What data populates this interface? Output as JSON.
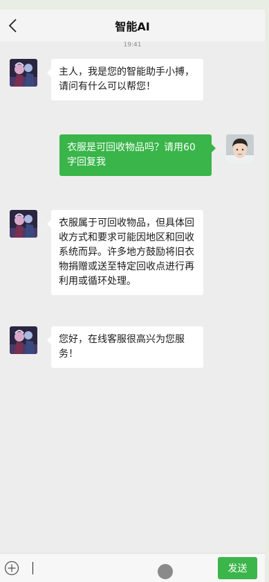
{
  "header": {
    "title": "智能AI",
    "back_icon": "chevron-left-icon"
  },
  "timestamp": "19:41",
  "messages": [
    {
      "side": "left",
      "sender": "ai",
      "text": "主人，我是您的智能助手小搏，请问有什么可以帮您！"
    },
    {
      "side": "right",
      "sender": "user",
      "text": "衣服是可回收物品吗？请用60字回复我"
    },
    {
      "side": "left",
      "sender": "ai",
      "text": "衣服属于可回收物品，但具体回收方式和要求可能因地区和回收系统而异。许多地方鼓励将旧衣物捐赠或送至特定回收点进行再利用或循环处理。"
    },
    {
      "side": "left",
      "sender": "ai",
      "text": "您好，在线客服很高兴为您服务！"
    }
  ],
  "input": {
    "value": "",
    "placeholder": ""
  },
  "bottom_bar": {
    "add_icon": "plus-circle-icon",
    "send_label": "发送"
  },
  "colors": {
    "user_bubble": "#39b54a",
    "send_button": "#3cb54b",
    "ai_bubble": "#ffffff",
    "chat_background": "#ededed"
  }
}
